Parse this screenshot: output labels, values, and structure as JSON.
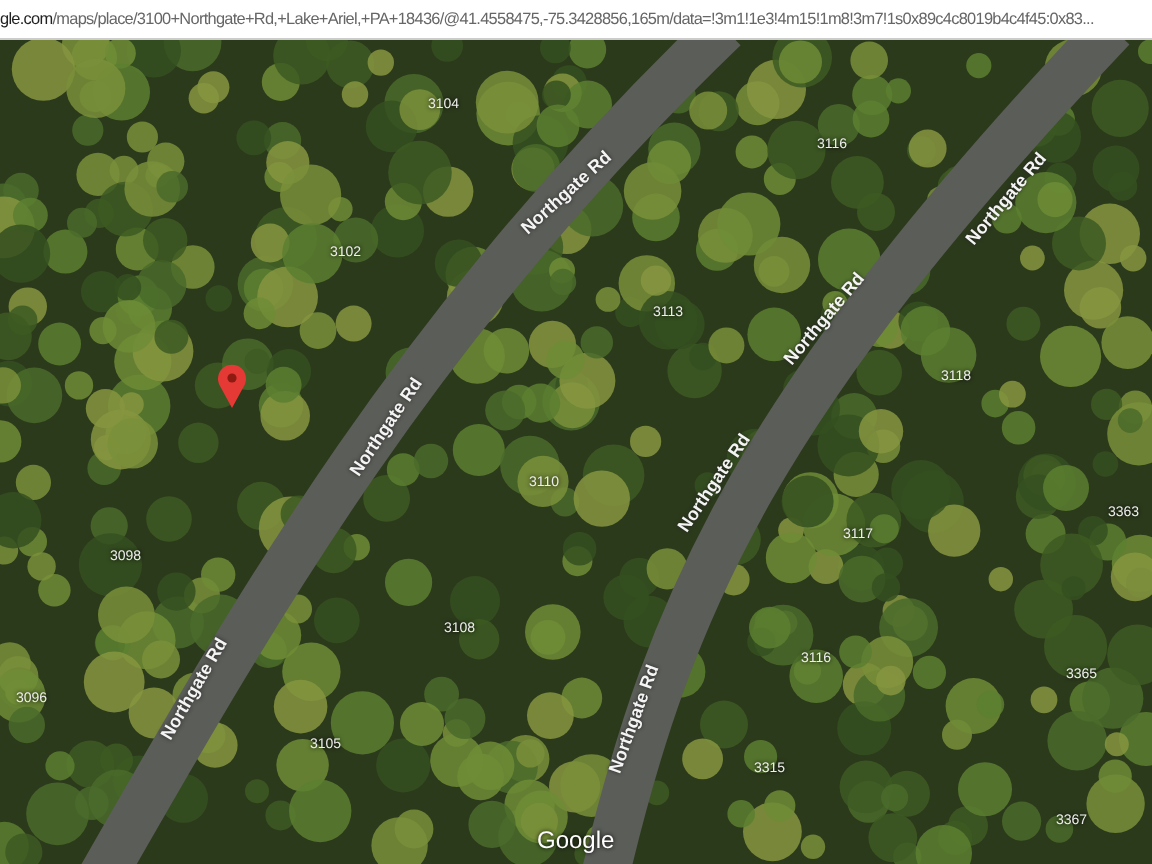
{
  "address_bar": {
    "host": "gle.com",
    "path": "/maps/place/3100+Northgate+Rd,+Lake+Ariel,+PA+18436/@41.4558475,-75.3428856,165m/data=!3m1!1e3!4m15!1m8!3m7!1s0x89c4c8019b4c4f45:0x83..."
  },
  "map": {
    "road_labels": [
      "Northgate Rd",
      "Northgate Rd",
      "Northgate Rd",
      "Northgate Rd",
      "Northgate Rd",
      "Northgate Rd",
      "Northgate Rd"
    ],
    "address_numbers": [
      "3104",
      "3102",
      "3116",
      "3113",
      "3118",
      "3110",
      "3117",
      "3098",
      "3108",
      "3116",
      "3363",
      "3365",
      "3096",
      "3105",
      "3315",
      "3367"
    ],
    "attribution": "Google"
  }
}
